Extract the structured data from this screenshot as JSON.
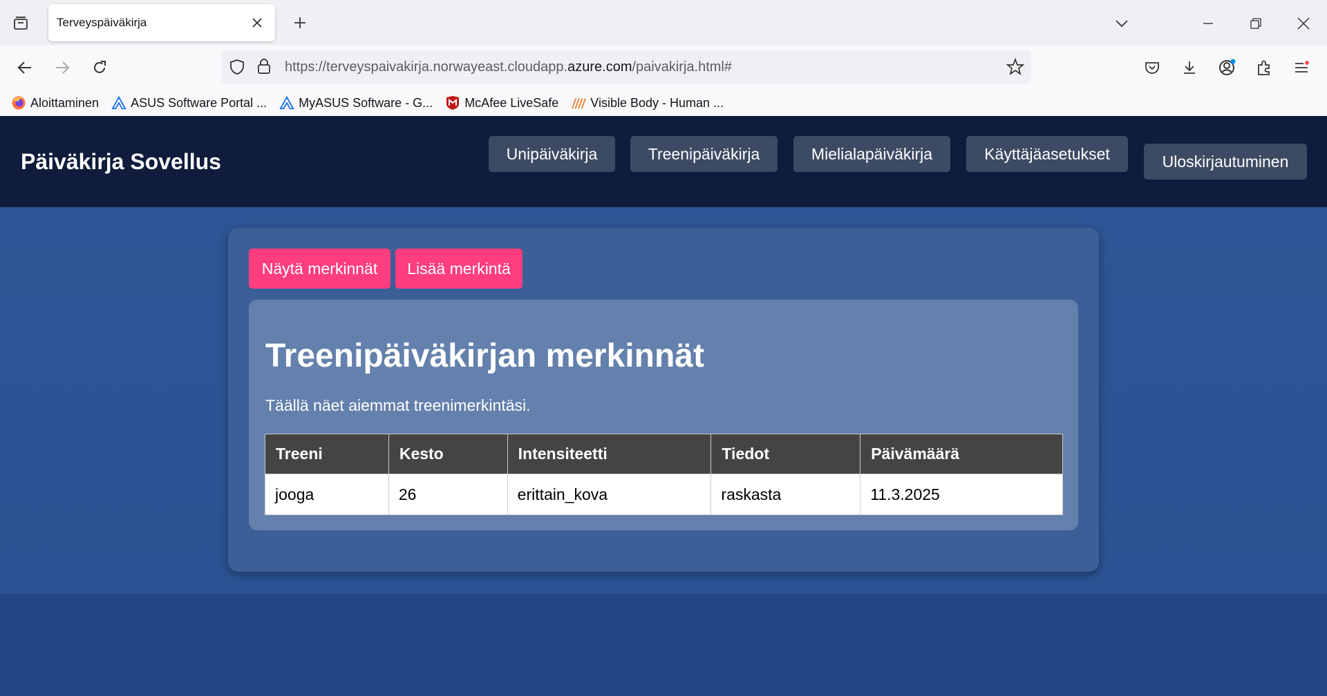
{
  "browser": {
    "tab": {
      "title": "Terveyspäiväkirja"
    },
    "url": {
      "prefix": "https://terveyspaivakirja.norwayeast.cloudapp.",
      "domain": "azure.com",
      "path": "/paivakirja.html#"
    },
    "bookmarks": [
      {
        "label": "Aloittaminen",
        "icon": "firefox-icon"
      },
      {
        "label": "ASUS Software Portal ...",
        "icon": "asus-icon"
      },
      {
        "label": "MyASUS Software - G...",
        "icon": "asus-icon"
      },
      {
        "label": "McAfee LiveSafe",
        "icon": "mcafee-icon"
      },
      {
        "label": "Visible Body - Human ...",
        "icon": "visible-body-icon"
      }
    ]
  },
  "site": {
    "title": "Päiväkirja Sovellus",
    "menu": [
      "Unipäiväkirja",
      "Treenipäiväkirja",
      "Mielialapäiväkirja",
      "Käyttäjäasetukset",
      "Uloskirjautuminen"
    ]
  },
  "main": {
    "show_button": "Näytä merkinnät",
    "add_button": "Lisää merkintä",
    "heading": "Treenipäiväkirjan merkinnät",
    "description": "Täällä näet aiemmat treenimerkintäsi.",
    "table": {
      "headers": [
        "Treeni",
        "Kesto",
        "Intensiteetti",
        "Tiedot",
        "Päivämäärä"
      ],
      "rows": [
        [
          "jooga",
          "26",
          "erittain_kova",
          "raskasta",
          "11.3.2025"
        ]
      ]
    }
  },
  "colors": {
    "header_bg": "#0f1c3b",
    "accent_pink": "#ff3d7f",
    "menu_button": "#3d4a63"
  }
}
